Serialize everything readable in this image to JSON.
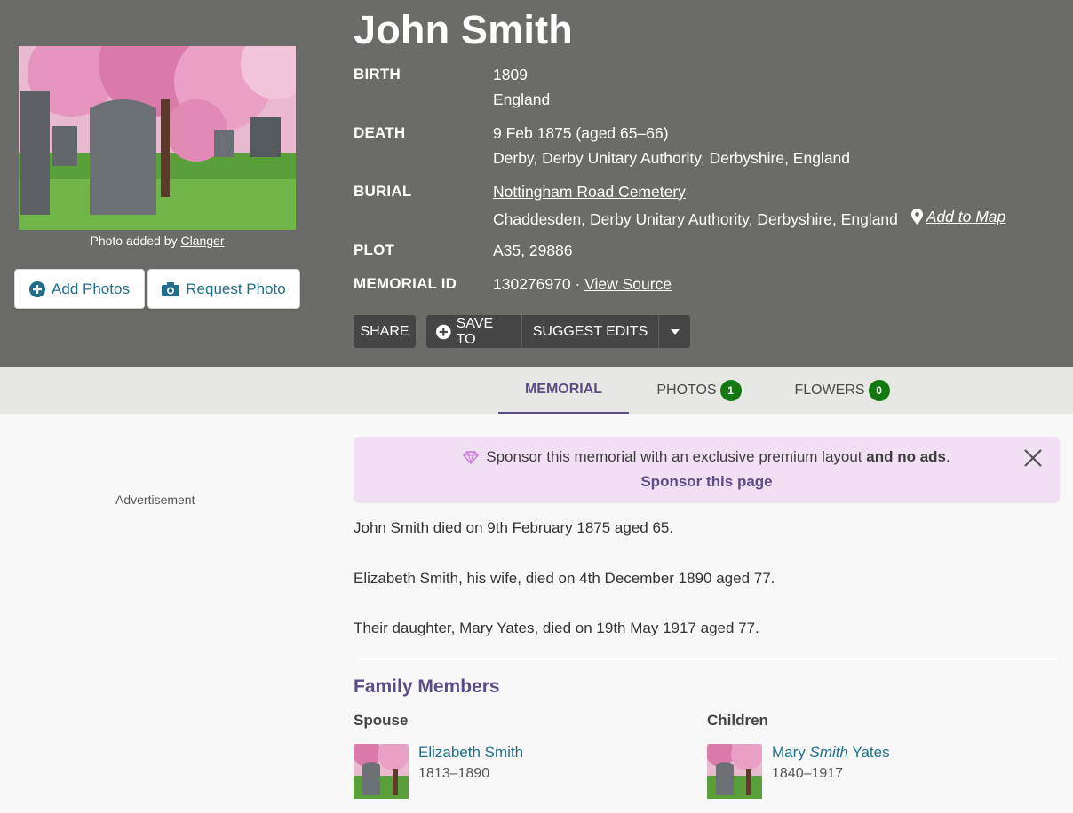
{
  "photo": {
    "credit_prefix": "Photo added by ",
    "credit_user": "Clanger",
    "add_label": "Add Photos",
    "request_label": "Request Photo"
  },
  "person": {
    "name": "John Smith",
    "birth_label": "BIRTH",
    "birth_date": "1809",
    "birth_place": "England",
    "death_label": "DEATH",
    "death_date": "9 Feb 1875 (aged 65–66)",
    "death_place": "Derby, Derby Unitary Authority, Derbyshire, England",
    "burial_label": "BURIAL",
    "burial_cemetery": "Nottingham Road Cemetery",
    "burial_place": "Chaddesden, Derby Unitary Authority, Derbyshire, England",
    "add_to_map": "Add to Map",
    "plot_label": "PLOT",
    "plot": "A35, 29886",
    "memorial_label": "MEMORIAL ID",
    "memorial_id": "130276970 · ",
    "view_source": "View Source"
  },
  "actions": {
    "share": "SHARE",
    "save_to": "SAVE TO",
    "suggest": "SUGGEST EDITS"
  },
  "tabs": {
    "memorial": "MEMORIAL",
    "photos": "PHOTOS",
    "photos_count": "1",
    "flowers": "FLOWERS",
    "flowers_count": "0"
  },
  "ad": {
    "label": "Advertisement"
  },
  "sponsor": {
    "text": "Sponsor this memorial with an exclusive premium layout ",
    "text_bold": "and no ads",
    "text_end": ".",
    "link": "Sponsor this page"
  },
  "bio": {
    "line1": "John Smith died on 9th February 1875 aged 65.",
    "line2": "Elizabeth Smith, his wife, died on 4th December 1890 aged 77.",
    "line3": "Their daughter, Mary Yates, died on 19th May 1917 aged 77."
  },
  "family": {
    "title": "Family Members",
    "spouse_label": "Spouse",
    "children_label": "Children",
    "spouse": {
      "name": "Elizabeth Smith",
      "dates": "1813–1890"
    },
    "child": {
      "first": "Mary ",
      "maiden": "Smith",
      "last": " Yates",
      "dates": "1840–1917"
    }
  },
  "colors": {
    "hero_bg": "#6b6b68",
    "accent_purple": "#5b4d86",
    "link_teal": "#1f6f8b",
    "badge_green": "#137a13",
    "sponsor_bg": "#f1dff3"
  }
}
